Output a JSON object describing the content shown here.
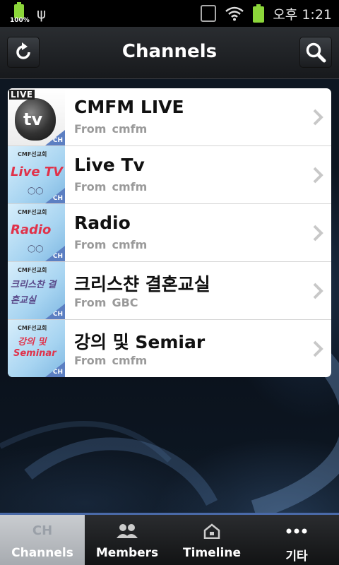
{
  "status_bar": {
    "battery_percent_label": "100%",
    "time": "오후 1:21",
    "icons": [
      "battery-icon",
      "usb-icon",
      "vibrate-icon",
      "wifi-icon",
      "battery-icon"
    ]
  },
  "header": {
    "title": "Channels",
    "refresh_icon": "refresh-icon",
    "search_icon": "search-icon"
  },
  "channels": [
    {
      "name": "CMFM LIVE",
      "from_label": "From",
      "owner": "cmfm",
      "thumb": "live-tv"
    },
    {
      "name": "Live Tv",
      "from_label": "From",
      "owner": "cmfm",
      "thumb": "live-tv-logo"
    },
    {
      "name": "Radio",
      "from_label": "From",
      "owner": "cmfm",
      "thumb": "radio-logo"
    },
    {
      "name": "크리스챤 결혼교실",
      "from_label": "From",
      "owner": "GBC",
      "thumb": "wedding-class"
    },
    {
      "name": "강의 및 Semiar",
      "from_label": "From",
      "owner": "cmfm",
      "thumb": "seminar"
    }
  ],
  "thumb_text": {
    "live": "LIVE",
    "tv": "tv",
    "ch": "CH",
    "cmf": "CMF선교회",
    "live_tv": "Live TV",
    "radio": "Radio",
    "wedding": "크리스찬 결혼교실",
    "seminar_ko": "강의 및",
    "seminar_en": "Seminar"
  },
  "tabs": [
    {
      "label": "Channels",
      "icon": "ch-icon",
      "icon_text": "CH",
      "active": true
    },
    {
      "label": "Members",
      "icon": "members-icon",
      "active": false
    },
    {
      "label": "Timeline",
      "icon": "home-icon",
      "active": false
    },
    {
      "label": "기타",
      "icon": "more-icon",
      "active": false
    }
  ],
  "colors": {
    "accent": "#4a6aa8",
    "battery": "#8cd63a",
    "ch_badge": "#5c7fc2"
  }
}
